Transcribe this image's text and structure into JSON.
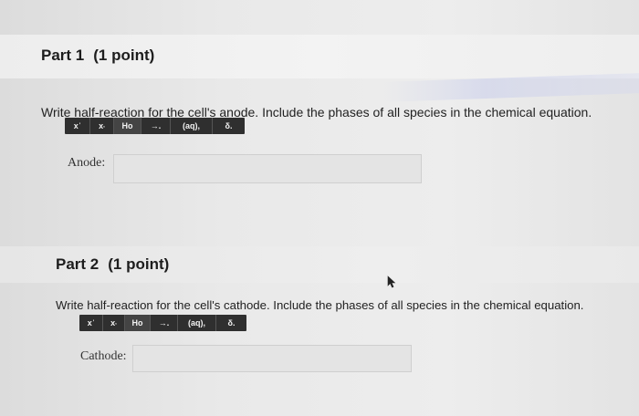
{
  "part1": {
    "heading": "Part 1",
    "points": "(1 point)",
    "prompt": "Write half-reaction for the cell's anode. Include the phases of all species in the chemical equation.",
    "toolbar": {
      "btn_superscript": "x",
      "btn_superscript_sup": "'",
      "btn_subscript": "x",
      "btn_subscript_sub": ",",
      "btn_ion": "Ho",
      "btn_arrow": "→.",
      "btn_phase": "(aq),",
      "btn_delta": "δ."
    },
    "answer_label": "Anode:",
    "answer_value": ""
  },
  "part2": {
    "heading": "Part 2",
    "points": "(1 point)",
    "prompt": "Write half-reaction for the cell's cathode. Include the phases of all species in the chemical equation.",
    "toolbar": {
      "btn_superscript": "x",
      "btn_superscript_sup": "'",
      "btn_subscript": "x",
      "btn_subscript_sub": ",",
      "btn_ion": "Ho",
      "btn_arrow": "→.",
      "btn_phase": "(aq),",
      "btn_delta": "δ."
    },
    "answer_label": "Cathode:",
    "answer_value": ""
  },
  "icons": {
    "cursor": "mouse-pointer-icon"
  }
}
